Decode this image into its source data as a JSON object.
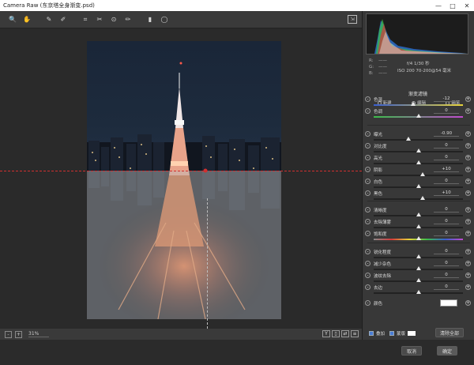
{
  "window": {
    "title": "Camera Raw (东京塔全身渐变.psd)",
    "min_label": "—",
    "max_label": "□",
    "close_label": "✕"
  },
  "toolbar": {
    "tools": [
      {
        "name": "zoom-tool-icon",
        "glyph": "🔍"
      },
      {
        "name": "hand-tool-icon",
        "glyph": "✋"
      },
      {
        "name": "white-balance-tool-icon",
        "glyph": "✎"
      },
      {
        "name": "color-sampler-tool-icon",
        "glyph": "✐"
      },
      {
        "name": "crop-tool-icon",
        "glyph": "⌗"
      },
      {
        "name": "spot-removal-tool-icon",
        "glyph": "✂"
      },
      {
        "name": "red-eye-tool-icon",
        "glyph": "⊙"
      },
      {
        "name": "adjustment-brush-icon",
        "glyph": "✏"
      },
      {
        "name": "graduated-filter-icon",
        "glyph": "▮"
      },
      {
        "name": "radial-filter-icon",
        "glyph": "◯"
      }
    ],
    "export_glyph": "⇲"
  },
  "bottom": {
    "zoom_out": "-",
    "zoom_in": "+",
    "zoom_value": "31%",
    "view_y": "Y",
    "view_compare": "▯",
    "view_swap": "⇄",
    "view_menu": "≡"
  },
  "info": {
    "r": "R:",
    "g": "G:",
    "b": "B:",
    "dash": "——",
    "exposure_line": "f/4  1/30 秒",
    "iso_line": "ISO 200  70-200@54 毫米"
  },
  "panel": {
    "section_title": "渐变滤镜",
    "modes": [
      "新建",
      "编辑",
      "画笔"
    ],
    "sliders": [
      {
        "name": "色温",
        "value": "-12",
        "pos": 0.44,
        "track": "temp"
      },
      {
        "name": "色调",
        "value": "0",
        "pos": 0.5,
        "track": "tint"
      },
      {
        "name": "曝光",
        "value": "-0.90",
        "pos": 0.39,
        "track": "plain"
      },
      {
        "name": "对比度",
        "value": "0",
        "pos": 0.5,
        "track": "plain"
      },
      {
        "name": "高光",
        "value": "0",
        "pos": 0.5,
        "track": "plain"
      },
      {
        "name": "阴影",
        "value": "+10",
        "pos": 0.55,
        "track": "plain"
      },
      {
        "name": "白色",
        "value": "0",
        "pos": 0.5,
        "track": "plain"
      },
      {
        "name": "黑色",
        "value": "+10",
        "pos": 0.55,
        "track": "plain"
      },
      {
        "name": "清晰度",
        "value": "0",
        "pos": 0.5,
        "track": "plain"
      },
      {
        "name": "去除薄雾",
        "value": "0",
        "pos": 0.5,
        "track": "plain"
      },
      {
        "name": "饱和度",
        "value": "0",
        "pos": 0.5,
        "track": "sat"
      },
      {
        "name": "锐化程度",
        "value": "0",
        "pos": 0.5,
        "track": "plain"
      },
      {
        "name": "减少杂色",
        "value": "0",
        "pos": 0.5,
        "track": "plain"
      },
      {
        "name": "波纹去除",
        "value": "0",
        "pos": 0.5,
        "track": "plain"
      },
      {
        "name": "去边",
        "value": "0",
        "pos": 0.5,
        "track": "plain"
      }
    ],
    "color_label": "颜色",
    "overlay_label": "叠加",
    "mask_label": "蒙版",
    "clear_all": "清除全部"
  },
  "footer": {
    "cancel": "取消",
    "ok": "确定"
  },
  "colors": {
    "panel_bg": "#383838",
    "canvas_bg": "#2a2a2a",
    "guide_red": "#d03030",
    "checkbox_blue": "#4a7dd6"
  }
}
